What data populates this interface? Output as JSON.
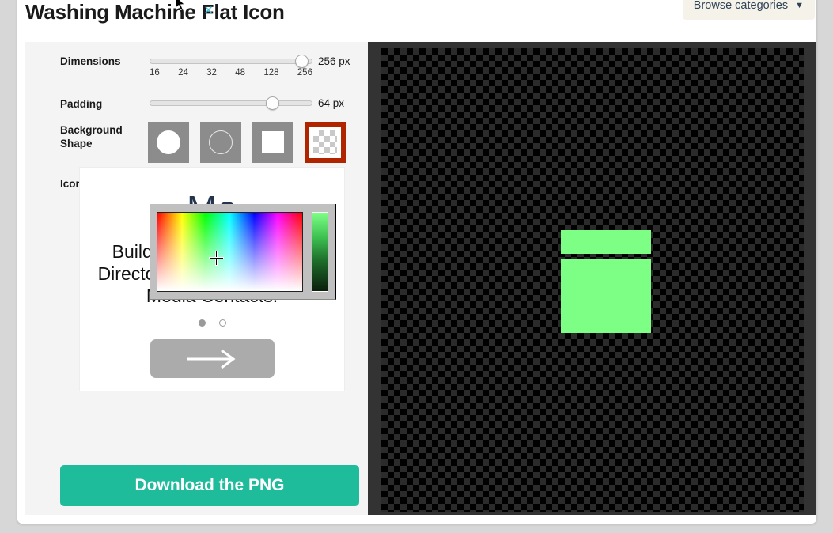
{
  "header": {
    "title": "Washing Machine Flat Icon",
    "browse_categories_label": "Browse categories",
    "caret_glyph": "▼"
  },
  "controls": {
    "dimensions": {
      "label": "Dimensions",
      "value_text": "256 px",
      "value": 256,
      "ticks": [
        "16",
        "24",
        "32",
        "48",
        "128",
        "256"
      ]
    },
    "padding": {
      "label": "Padding",
      "value_text": "64 px",
      "value": 64
    },
    "background_shape": {
      "label": "Background Shape",
      "options": [
        {
          "name": "circle-filled",
          "selected": false
        },
        {
          "name": "circle-outline",
          "selected": false
        },
        {
          "name": "square",
          "selected": false
        },
        {
          "name": "transparent",
          "selected": true
        }
      ]
    },
    "icon_color": {
      "label": "Icon Color",
      "value": "7DFF86",
      "swatch_hex": "#7DFF86"
    },
    "download_label": "Download the PNG"
  },
  "color_picker": {
    "close_glyph": "×",
    "selected_hex": "#7DFF86",
    "visible": true
  },
  "advertisement": {
    "heading": "Me",
    "body": "Build Targeted Lists With Directory Of Over 1.4 Million Media Contacts.",
    "cta_glyph": "→",
    "dots": [
      {
        "state": "filled"
      },
      {
        "state": "empty"
      }
    ]
  },
  "preview": {
    "icon_name": "washing-machine-icon",
    "icon_color": "#7DFF86",
    "background": "transparent-checkerboard"
  }
}
